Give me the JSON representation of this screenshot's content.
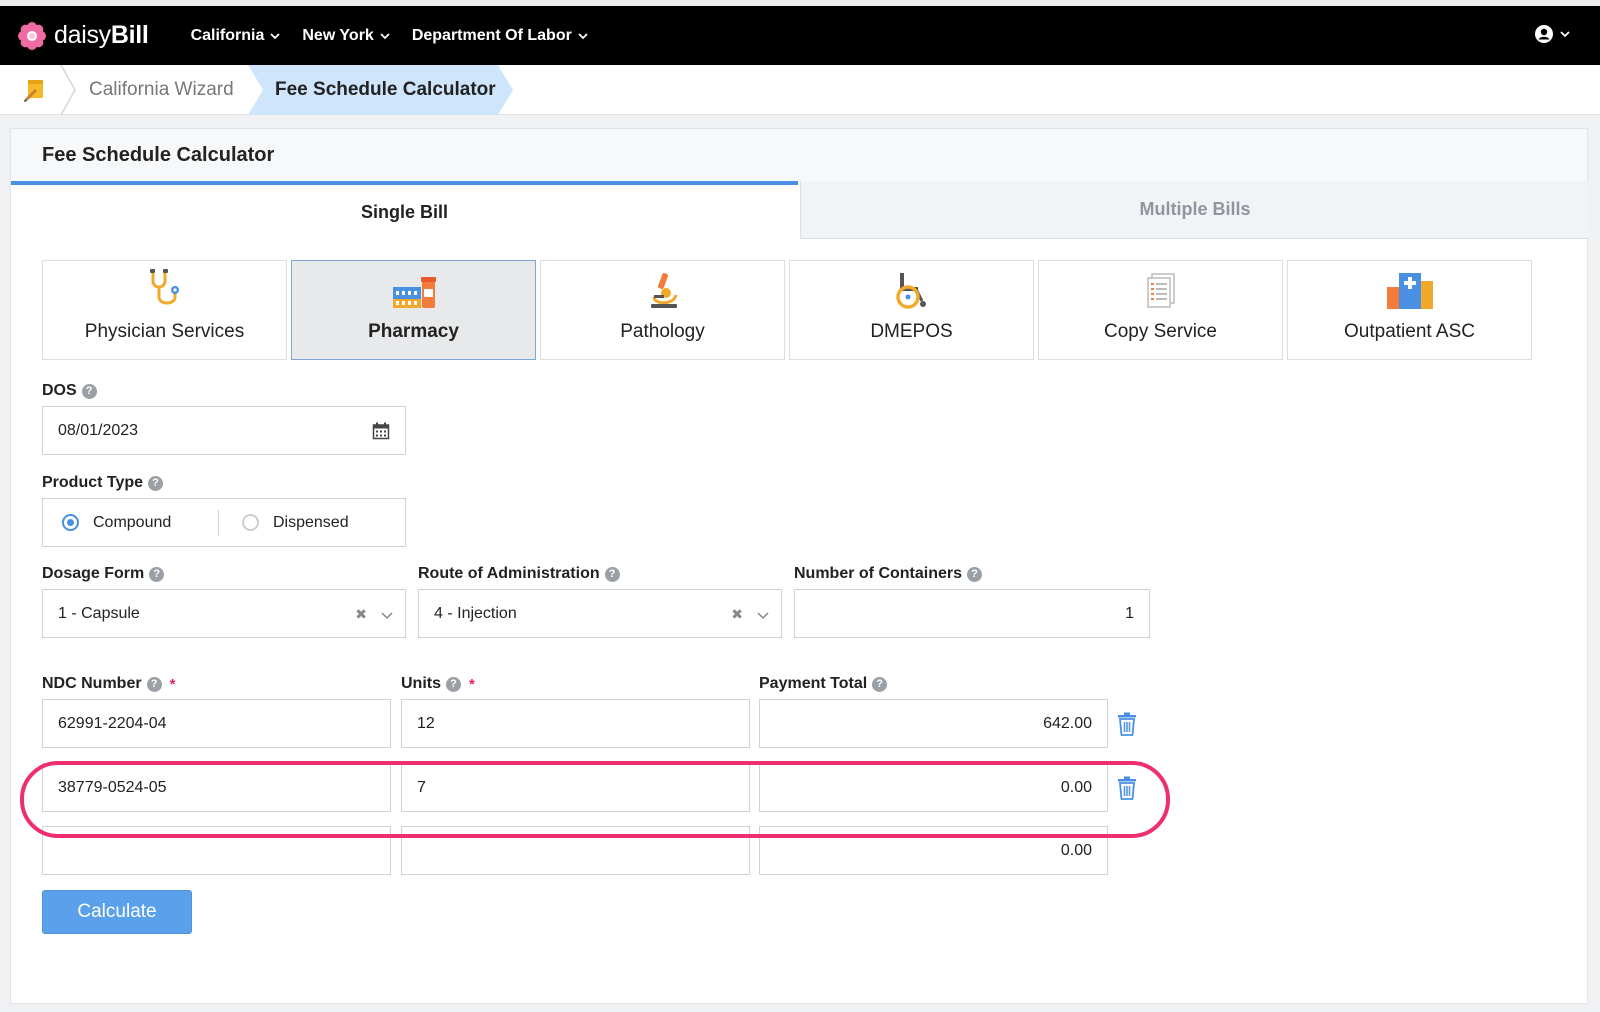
{
  "navbar": {
    "logo_light": "daisy",
    "logo_bold": "Bill",
    "menus": [
      {
        "label": "California"
      },
      {
        "label": "New York"
      },
      {
        "label": "Department Of Labor"
      }
    ]
  },
  "breadcrumb": {
    "items": [
      {
        "label": "California Wizard"
      },
      {
        "label": "Fee Schedule Calculator"
      }
    ]
  },
  "panel": {
    "title": "Fee Schedule Calculator",
    "tabs": [
      {
        "label": "Single Bill",
        "active": true
      },
      {
        "label": "Multiple Bills",
        "active": false
      }
    ],
    "service_types": [
      {
        "label": "Physician Services",
        "icon": "stethoscope-icon"
      },
      {
        "label": "Pharmacy",
        "icon": "pharmacy-icon",
        "active": true
      },
      {
        "label": "Pathology",
        "icon": "microscope-icon"
      },
      {
        "label": "DMEPOS",
        "icon": "wheelchair-icon"
      },
      {
        "label": "Copy Service",
        "icon": "document-icon"
      },
      {
        "label": "Outpatient ASC",
        "icon": "hospital-icon"
      }
    ]
  },
  "form": {
    "dos": {
      "label": "DOS",
      "value": "08/01/2023"
    },
    "product_type": {
      "label": "Product Type",
      "options": [
        {
          "label": "Compound",
          "selected": true
        },
        {
          "label": "Dispensed",
          "selected": false
        }
      ]
    },
    "dosage_form": {
      "label": "Dosage Form",
      "value": "1 - Capsule"
    },
    "route": {
      "label": "Route of Administration",
      "value": "4 - Injection"
    },
    "containers": {
      "label": "Number of Containers",
      "value": "1"
    },
    "columns": {
      "ndc": "NDC Number",
      "units": "Units",
      "payment": "Payment Total",
      "required_mark": "*"
    },
    "rows": [
      {
        "ndc": "62991-2204-04",
        "units": "12",
        "payment": "642.00"
      },
      {
        "ndc": "38779-0524-05",
        "units": "7",
        "payment": "0.00"
      },
      {
        "ndc": "",
        "units": "",
        "payment": "0.00"
      }
    ],
    "calculate_label": "Calculate"
  },
  "colors": {
    "accent": "#4a90e2",
    "highlight": "#ef2e6e",
    "navbar": "#000000"
  }
}
